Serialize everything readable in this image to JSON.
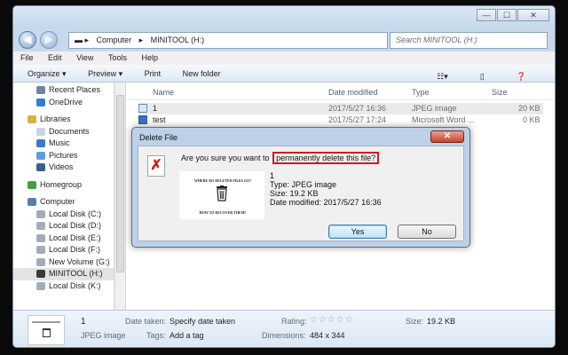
{
  "window": {
    "controls": {
      "minimize": "—",
      "maximize": "☐",
      "close": "✕"
    }
  },
  "address": {
    "crumbs": [
      "Computer",
      "MINITOOL (H:)"
    ],
    "search_placeholder": "Search MINITOOL (H:)"
  },
  "menu": [
    "File",
    "Edit",
    "View",
    "Tools",
    "Help"
  ],
  "commands": [
    "Organize ▾",
    "Preview ▾",
    "Print",
    "New folder"
  ],
  "sidebar": {
    "items": [
      {
        "label": "Recent Places",
        "level": "sub",
        "icon": "recent-places-icon",
        "color": "#6f87a3"
      },
      {
        "label": "OneDrive",
        "level": "sub",
        "icon": "onedrive-icon",
        "color": "#2f7fd6"
      },
      {
        "label": "",
        "level": "gap"
      },
      {
        "label": "Libraries",
        "level": "top",
        "icon": "libraries-icon",
        "color": "#d7b24a"
      },
      {
        "label": "Documents",
        "level": "sub",
        "icon": "documents-icon",
        "color": "#c8d4e2"
      },
      {
        "label": "Music",
        "level": "sub",
        "icon": "music-icon",
        "color": "#3a79c8"
      },
      {
        "label": "Pictures",
        "level": "sub",
        "icon": "pictures-icon",
        "color": "#5c9ed9"
      },
      {
        "label": "Videos",
        "level": "sub",
        "icon": "videos-icon",
        "color": "#3d5f8f"
      },
      {
        "label": "",
        "level": "gap"
      },
      {
        "label": "Homegroup",
        "level": "top",
        "icon": "homegroup-icon",
        "color": "#3fa33f"
      },
      {
        "label": "",
        "level": "gap"
      },
      {
        "label": "Computer",
        "level": "top",
        "icon": "computer-icon",
        "color": "#5b7ea8"
      },
      {
        "label": "Local Disk (C:)",
        "level": "sub",
        "icon": "disk-icon",
        "color": "#a3adb8"
      },
      {
        "label": "Local Disk (D:)",
        "level": "sub",
        "icon": "disk-icon",
        "color": "#a3adb8"
      },
      {
        "label": "Local Disk (E:)",
        "level": "sub",
        "icon": "disk-icon",
        "color": "#a3adb8"
      },
      {
        "label": "Local Disk (F:)",
        "level": "sub",
        "icon": "disk-icon",
        "color": "#a3adb8"
      },
      {
        "label": "New Volume (G:)",
        "level": "sub",
        "icon": "disk-icon",
        "color": "#a3adb8"
      },
      {
        "label": "MINITOOL (H:)",
        "level": "sub",
        "icon": "usb-drive-icon",
        "color": "#3b3b3b",
        "selected": true
      },
      {
        "label": "Local Disk (K:)",
        "level": "sub",
        "icon": "disk-icon",
        "color": "#a3adb8"
      }
    ]
  },
  "columns": {
    "name": "Name",
    "date": "Date modified",
    "type": "Type",
    "size": "Size"
  },
  "files": [
    {
      "name": "1",
      "date": "2017/5/27 16:36",
      "type": "JPEG image",
      "size": "20 KB",
      "icon": "jpeg-file-icon",
      "selected": true
    },
    {
      "name": "test",
      "date": "2017/5/27 17:24",
      "type": "Microsoft Word ...",
      "size": "0 KB",
      "icon": "word-file-icon"
    }
  ],
  "details": {
    "name": "1",
    "type": "JPEG image",
    "date_taken_label": "Date taken:",
    "date_taken_value": "Specify date taken",
    "tags_label": "Tags:",
    "tags_value": "Add a tag",
    "rating_label": "Rating:",
    "rating_stars": "☆☆☆☆☆",
    "dimensions_label": "Dimensions:",
    "dimensions_value": "484 x 344",
    "size_label": "Size:",
    "size_value": "19.2 KB"
  },
  "dialog": {
    "title": "Delete File",
    "question_prefix": "Are you sure you want to",
    "question_highlight": "permanently delete this file?",
    "preview_top": "WHERE DO DELETED FILES GO?",
    "preview_bottom": "HOW TO RECOVER THEM?",
    "file_name": "1",
    "file_type": "Type: JPEG image",
    "file_size": "Size: 19.2 KB",
    "file_date": "Date modified: 2017/5/27 16:36",
    "yes_label": "Yes",
    "no_label": "No",
    "highlight_color": "#d4152a"
  }
}
